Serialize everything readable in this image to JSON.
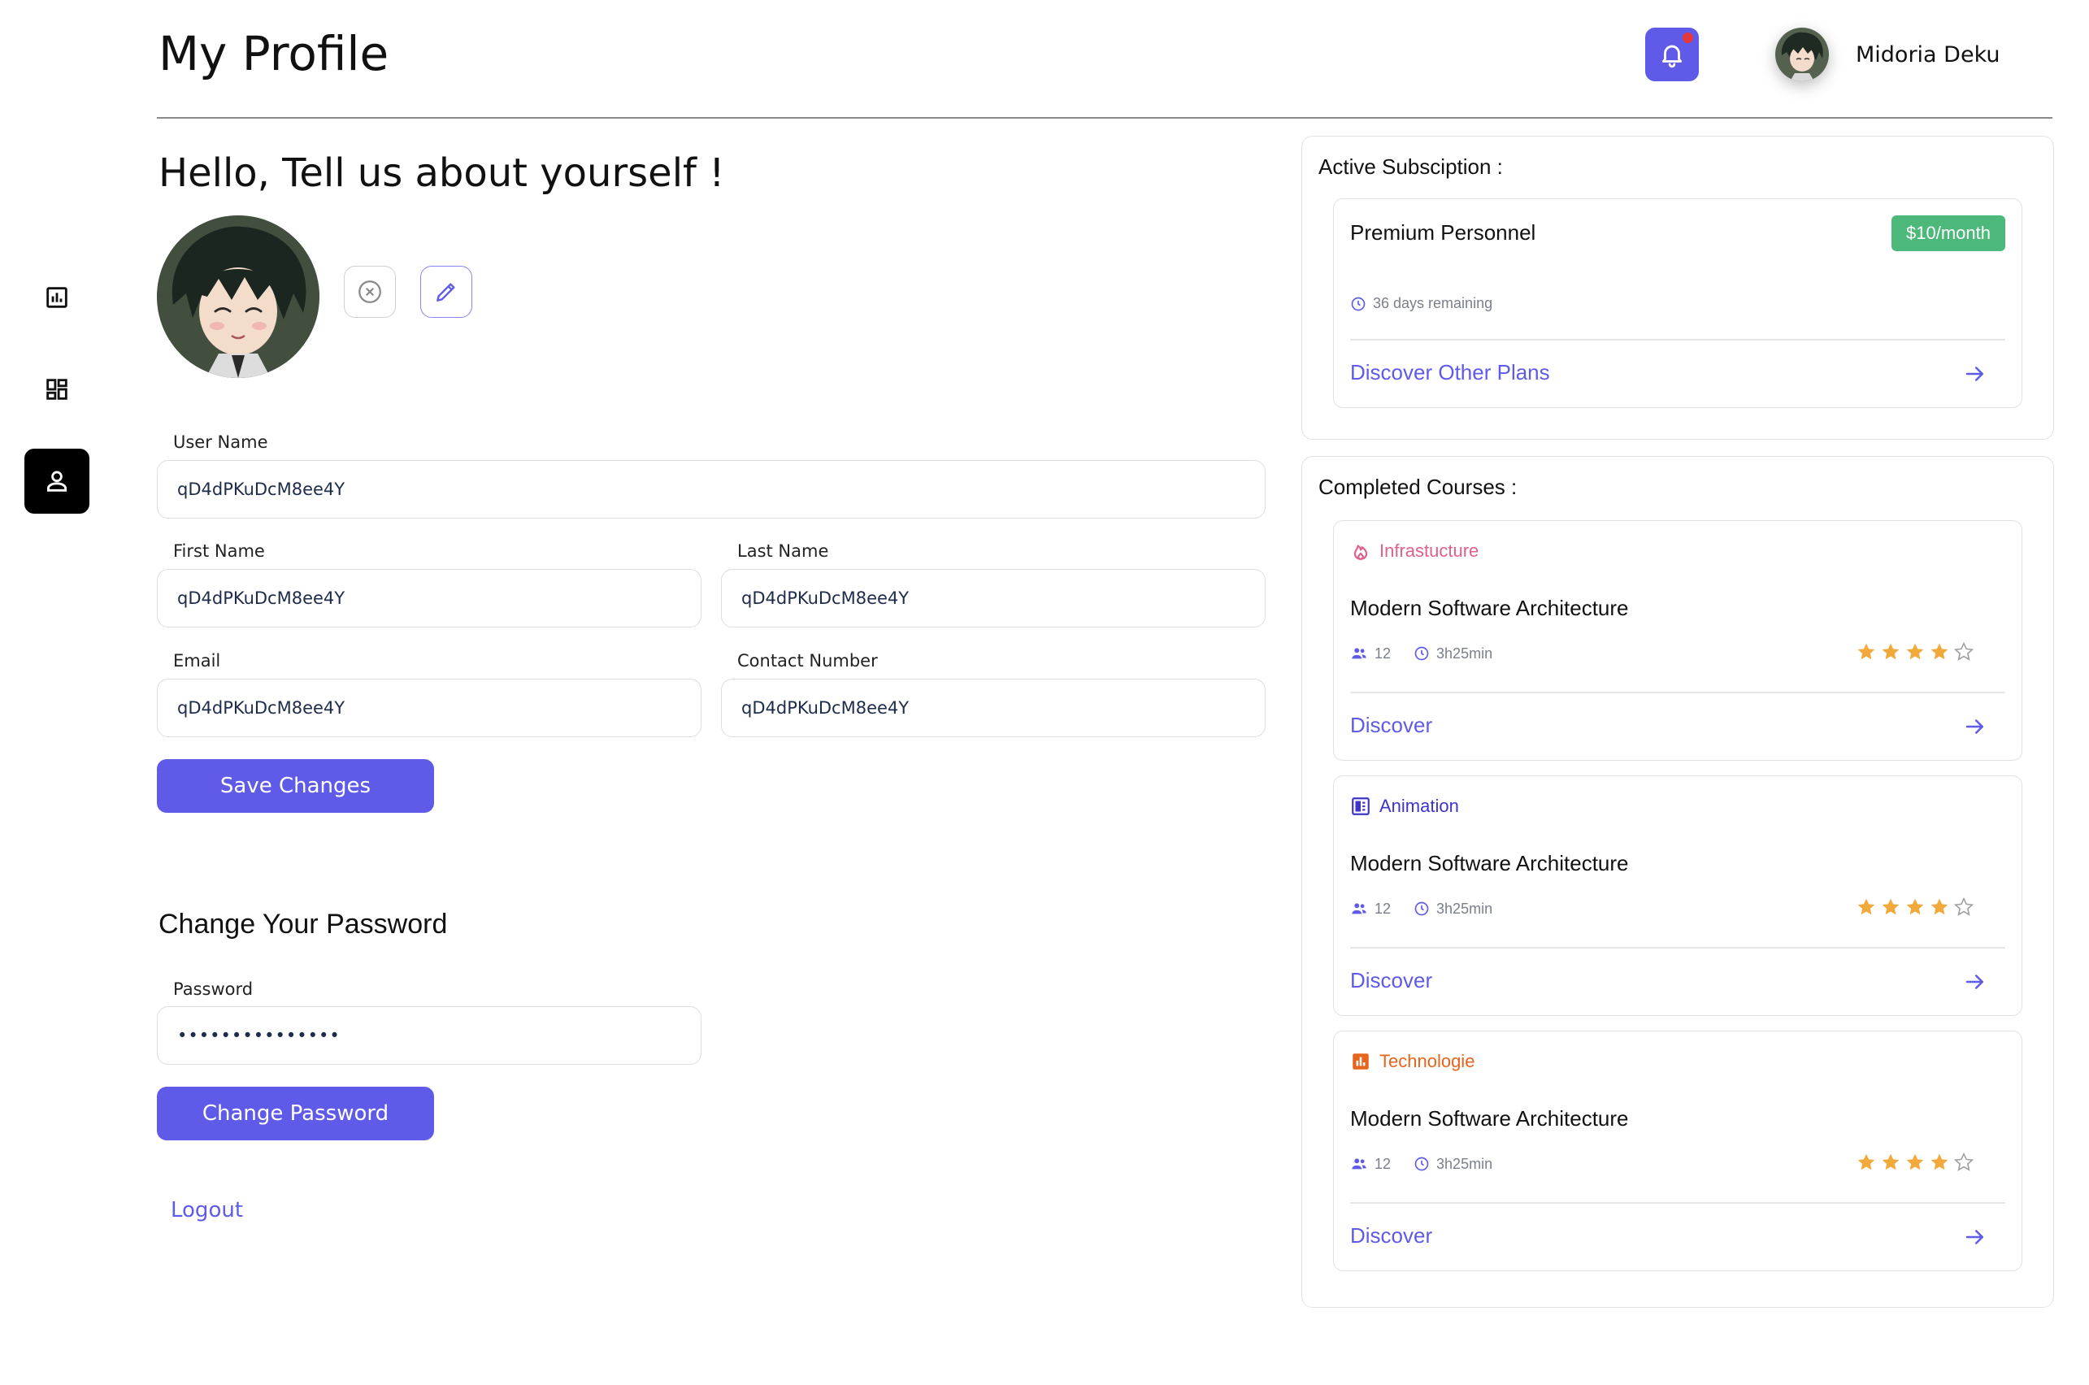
{
  "header": {
    "title": "My Profile",
    "user_name": "Midoria Deku"
  },
  "sidebar": {
    "items": [
      {
        "name": "analytics",
        "icon": "bar-chart-icon",
        "active": false
      },
      {
        "name": "dashboard",
        "icon": "dashboard-grid-icon",
        "active": false
      },
      {
        "name": "profile",
        "icon": "user-icon",
        "active": true
      }
    ]
  },
  "profile": {
    "heading": "Hello, Tell us about yourself !",
    "username_label": "User Name",
    "username_value": "qD4dPKuDcM8ee4Y",
    "first_name_label": "First Name",
    "first_name_value": "qD4dPKuDcM8ee4Y",
    "last_name_label": "Last Name",
    "last_name_value": "qD4dPKuDcM8ee4Y",
    "email_label": "Email",
    "email_value": "qD4dPKuDcM8ee4Y",
    "contact_label": "Contact Number",
    "contact_value": "qD4dPKuDcM8ee4Y",
    "save_label": "Save Changes"
  },
  "password": {
    "heading": "Change Your Password",
    "label": "Password",
    "value": "•••••••••••••••",
    "button_label": "Change Password"
  },
  "logout_label": "Logout",
  "subscription": {
    "title": "Active Subsciption :",
    "plan_name": "Premium Personnel",
    "price": "$10/month",
    "remaining": "36 days remaining",
    "link_label": "Discover Other Plans"
  },
  "courses": {
    "title": "Completed Courses :",
    "items": [
      {
        "category": "Infrastucture",
        "category_icon": "flame-icon",
        "category_color": "#e0608a",
        "title": "Modern Software Architecture",
        "students": "12",
        "duration": "3h25min",
        "rating": 4,
        "max_rating": 5,
        "link_label": "Discover"
      },
      {
        "category": "Animation",
        "category_icon": "film-icon",
        "category_color": "#3f33c9",
        "title": "Modern Software Architecture",
        "students": "12",
        "duration": "3h25min",
        "rating": 4,
        "max_rating": 5,
        "link_label": "Discover"
      },
      {
        "category": "Technologie",
        "category_icon": "bar-chart-icon",
        "category_color": "#e8641c",
        "title": "Modern Software Architecture",
        "students": "12",
        "duration": "3h25min",
        "rating": 4,
        "max_rating": 5,
        "link_label": "Discover"
      }
    ]
  },
  "colors": {
    "primary": "#5f5be8",
    "success": "#4cb87a",
    "star": "#f2a93b",
    "alert": "#e5383b"
  }
}
